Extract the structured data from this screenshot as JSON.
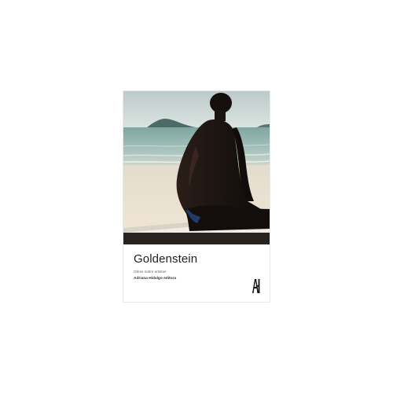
{
  "cover": {
    "title": "Goldenstein",
    "series": "Obras sobre artistas",
    "publisher": "Adriana Hidalgo editora",
    "logo_text": "AH"
  },
  "colors": {
    "sky": "#c9d6d6",
    "sea": "#8fb2ad",
    "sand": "#eae0d0",
    "silhouette": "#1a1412",
    "title_text": "#1f1f1f"
  }
}
